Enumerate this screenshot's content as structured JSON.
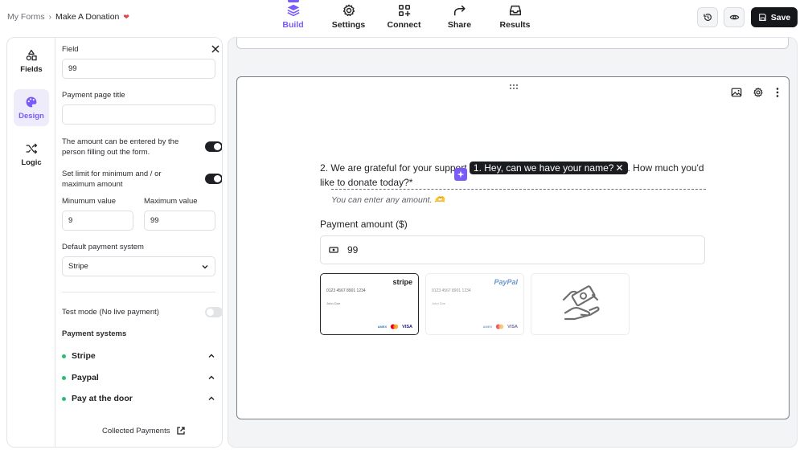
{
  "breadcrumb": {
    "root": "My Forms",
    "separator": "›",
    "current": "Make A Donation"
  },
  "nav": {
    "tabs": [
      {
        "label": "Build",
        "icon": "layers-icon",
        "active": true
      },
      {
        "label": "Settings",
        "icon": "gear-icon"
      },
      {
        "label": "Connect",
        "icon": "connect-icon"
      },
      {
        "label": "Share",
        "icon": "share-icon"
      },
      {
        "label": "Results",
        "icon": "inbox-icon"
      }
    ],
    "save_label": "Save"
  },
  "rail": {
    "items": [
      {
        "label": "Fields",
        "icon": "shapes-icon"
      },
      {
        "label": "Design",
        "icon": "palette-icon",
        "active": true
      },
      {
        "label": "Logic",
        "icon": "shuffle-icon"
      }
    ]
  },
  "settings": {
    "field_label": "Field",
    "field_value": "99",
    "page_title_label": "Payment page title",
    "page_title_value": "",
    "amount_entered_label": "The amount can be entered by the person filling out the form.",
    "amount_entered_on": true,
    "limit_label": "Set limit for minimum and / or maximum amount",
    "limit_on": true,
    "min_label": "Minumum value",
    "min_value": "9",
    "max_label": "Maximum value",
    "max_value": "99",
    "default_system_label": "Default payment system",
    "default_system_value": "Stripe",
    "test_mode_label": "Test mode (No live payment)",
    "test_mode_on": false,
    "payment_systems_label": "Payment systems",
    "payment_systems": [
      "Stripe",
      "Paypal",
      "Pay at the door"
    ],
    "collected_label": "Collected Payments"
  },
  "question": {
    "number": "2.",
    "text_before": "We are grateful for your support",
    "recall_pill": "1. Hey, can we have your name?",
    "text_after": ". How much you'd like to donate today?",
    "required_mark": "*",
    "hint": "You can enter any amount. 🫶",
    "amount_label": "Payment amount ($)",
    "amount_value": "99"
  },
  "payment_cards": [
    {
      "brand": "stripe",
      "number": "0123 4567 8901 1234",
      "holder": "John Doe",
      "selected": true
    },
    {
      "brand": "PayPal",
      "number": "0123 4567 8901 1234",
      "holder": "John Doe",
      "selected": false
    },
    {
      "brand": "pay at the door",
      "icon": "handshake-icon",
      "selected": false
    }
  ],
  "colors": {
    "accent": "#7a5af8",
    "dark": "#16171b",
    "success": "#2dbb74"
  }
}
